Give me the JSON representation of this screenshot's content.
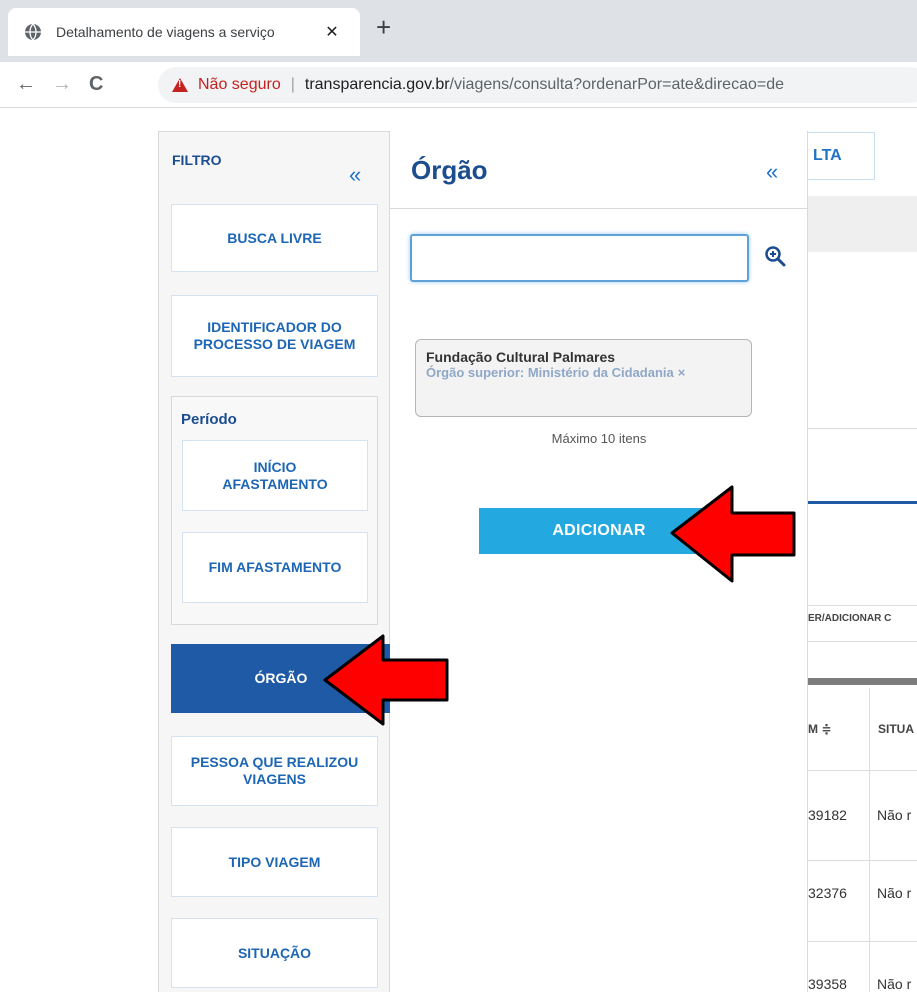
{
  "browser": {
    "tab_title": "Detalhamento de viagens a serviço",
    "tab_close": "✕",
    "new_tab": "+",
    "back": "←",
    "forward": "→",
    "reload": "C",
    "security_label": "Não seguro",
    "separator": "|",
    "url_host": "transparencia.gov.br",
    "url_rest": "/viagens/consulta?ordenarPor=ate&direcao=de"
  },
  "filter": {
    "title": "FILTRO",
    "collapse": "«",
    "buttons": {
      "busca_livre": "BUSCA LIVRE",
      "identificador": "IDENTIFICADOR DO PROCESSO DE VIAGEM",
      "orgao": "ÓRGÃO",
      "pessoa": "PESSOA QUE REALIZOU VIAGENS",
      "tipo_viagem": "TIPO VIAGEM",
      "situacao": "SITUAÇÃO"
    },
    "periodo": {
      "title": "Período",
      "inicio": "INÍCIO AFASTAMENTO",
      "fim": "FIM AFASTAMENTO"
    }
  },
  "orgao_panel": {
    "title": "Órgão",
    "collapse": "«",
    "search_value": "",
    "selected": {
      "name": "Fundação Cultural Palmares",
      "subtitle": "Órgão superior: Ministério da Cidadania",
      "remove": "×"
    },
    "max_items": "Máximo 10 itens",
    "add_label": "ADICIONAR"
  },
  "background_page": {
    "consulta_partial": "LTA",
    "column_toggle_partial": "ER/ADICIONAR C",
    "header_partial_1": "M ≑",
    "header_partial_2": "SITUA",
    "rows": [
      {
        "id": "39182",
        "status": "Não r"
      },
      {
        "id": "32376",
        "status": "Não r"
      },
      {
        "id": "39358",
        "status": "Não r"
      }
    ]
  },
  "colors": {
    "primary_blue": "#1f5aa6",
    "accent_cyan": "#24a8e0",
    "insecure_red": "#c5221f",
    "arrow_red": "#ff0000"
  }
}
